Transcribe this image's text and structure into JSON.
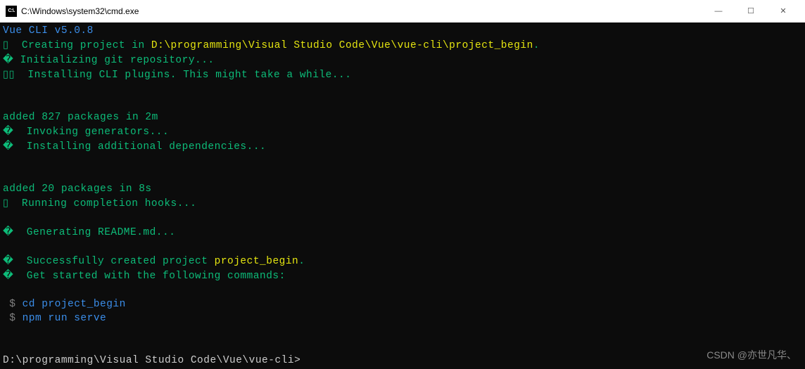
{
  "titlebar": {
    "icon_text": "C:\\.",
    "title": "C:\\Windows\\system32\\cmd.exe",
    "minimize": "—",
    "maximize": "☐",
    "close": "✕"
  },
  "content": {
    "vue_cli_version": "Vue CLI v5.0.8",
    "bullet1": "▯",
    "creating_prefix": "  Creating project in ",
    "creating_path": "D:\\programming\\Visual Studio Code\\Vue\\vue-cli\\project_begin",
    "creating_suffix": ".",
    "bullet2": "�",
    "init_git": " Initializing git repository...",
    "bullet3a": "▯",
    "bullet3b": "▯",
    "install_plugins": "  Installing CLI plugins. This might take a while...",
    "added1": "added 827 packages in 2m",
    "bullet4": "�",
    "invoking": "  Invoking generators...",
    "bullet5": "�",
    "install_addl": "  Installing additional dependencies...",
    "added2": "added 20 packages in 8s",
    "bullet6": "▯",
    "running_hooks": "  Running completion hooks...",
    "bullet7": "�",
    "gen_readme": "  Generating README.md...",
    "bullet8": "�",
    "success_prefix": "  Successfully created project ",
    "success_name": "project_begin",
    "success_suffix": ".",
    "bullet9": "�",
    "get_started": "  Get started with the following commands:",
    "dollar1": " $ ",
    "cmd_cd": "cd project_begin",
    "dollar2": " $ ",
    "cmd_npm": "npm run serve",
    "prompt": "D:\\programming\\Visual Studio Code\\Vue\\vue-cli>"
  },
  "watermark": "CSDN @亦世凡华、"
}
